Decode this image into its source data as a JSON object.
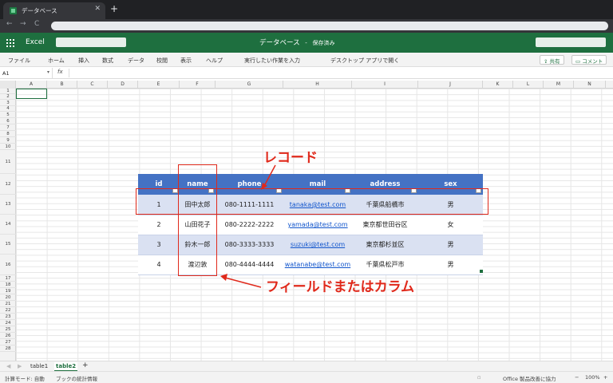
{
  "browser": {
    "tab_title": "データベース",
    "tab_close": "✕",
    "new_tab": "+",
    "back": "←",
    "forward": "→",
    "reload": "C"
  },
  "excel": {
    "app_name": "Excel",
    "doc_title": "データベース",
    "doc_separator": "-",
    "save_status": "保存済み",
    "accent_color": "#1e6f3f"
  },
  "menu": {
    "items": [
      "ファイル",
      "ホーム",
      "挿入",
      "数式",
      "データ",
      "校閲",
      "表示",
      "ヘルプ"
    ],
    "tell_me": "実行したい作業を入力",
    "open_desktop": "デスクトップ アプリで開く",
    "share": "共有",
    "comment": "コメント"
  },
  "formula_bar": {
    "name_box": "A1",
    "fx": "fx"
  },
  "grid": {
    "columns": [
      "A",
      "B",
      "C",
      "D",
      "E",
      "F",
      "G",
      "H",
      "I",
      "J",
      "K",
      "L",
      "M",
      "N"
    ],
    "rows": [
      "1",
      "2",
      "3",
      "4",
      "5",
      "6",
      "7",
      "8",
      "9",
      "10",
      "11",
      "12",
      "13",
      "14",
      "15",
      "16",
      "17",
      "18",
      "19",
      "20",
      "21",
      "22",
      "23",
      "24",
      "25",
      "26",
      "27",
      "28"
    ]
  },
  "table": {
    "headers": [
      "id",
      "name",
      "phone",
      "mail",
      "address",
      "sex"
    ],
    "rows": [
      [
        "1",
        "田中太郎",
        "080-1111-1111",
        "tanaka@test.com",
        "千葉県船橋市",
        "男"
      ],
      [
        "2",
        "山田花子",
        "080-2222-2222",
        "yamada@test.com",
        "東京都世田谷区",
        "女"
      ],
      [
        "3",
        "鈴木一郎",
        "080-3333-3333",
        "suzuki@test.com",
        "東京都杉並区",
        "男"
      ],
      [
        "4",
        "渡辺敦",
        "080-4444-4444",
        "watanabe@test.com",
        "千葉県松戸市",
        "男"
      ]
    ],
    "header_color": "#4472c4",
    "band_color": "#dae1f2"
  },
  "annotations": {
    "record_label": "レコード",
    "field_label": "フィールドまたはカラム",
    "color": "#e0291b"
  },
  "sheets": {
    "tabs": [
      "table1",
      "table2"
    ],
    "active": "table2",
    "add": "+"
  },
  "status": {
    "calc_mode": "計算モード: 自動",
    "stats": "ブックの統計情報",
    "feedback": "Office 製品改善に協力",
    "zoom_minus": "−",
    "zoom": "100%",
    "zoom_plus": "+"
  }
}
